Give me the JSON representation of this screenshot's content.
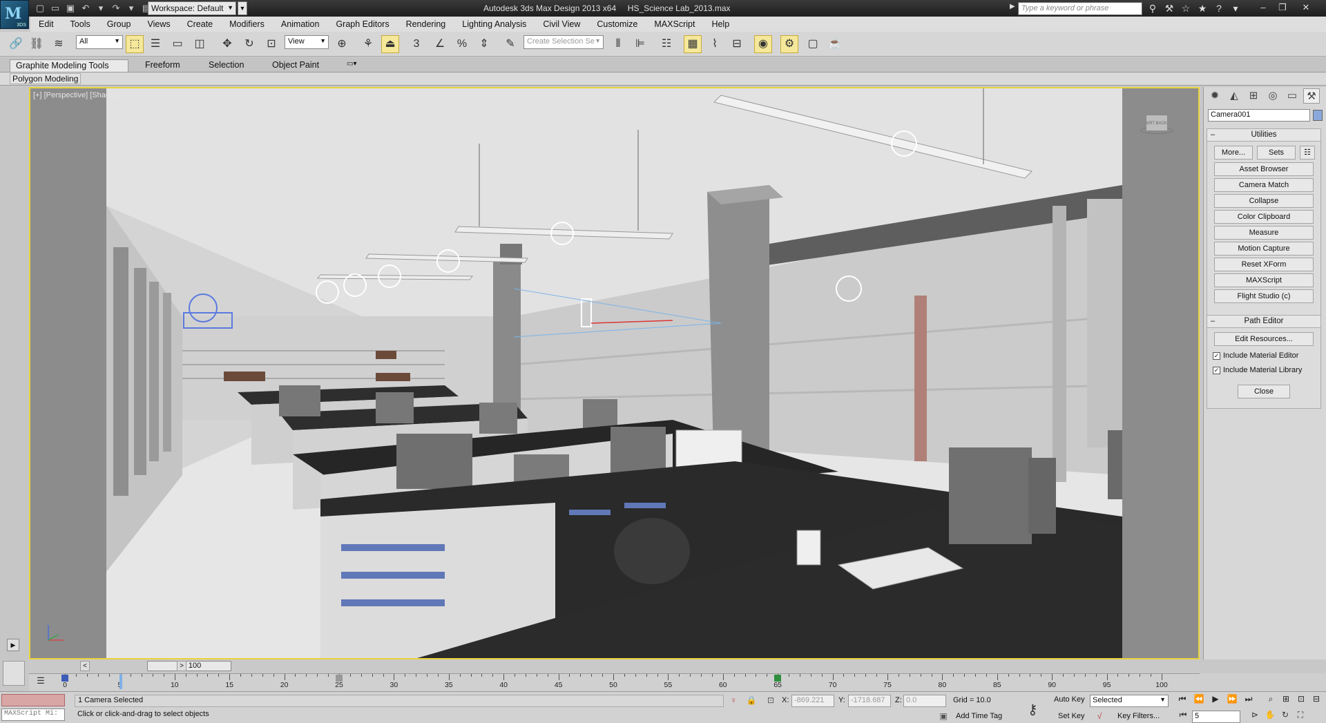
{
  "app": {
    "logo_text": "3DS",
    "title": "Autodesk 3ds Max Design 2013 x64     HS_Science Lab_2013.max",
    "workspace": "Workspace: Default",
    "search_placeholder": "Type a keyword or phrase"
  },
  "menu": [
    "Edit",
    "Tools",
    "Group",
    "Views",
    "Create",
    "Modifiers",
    "Animation",
    "Graph Editors",
    "Rendering",
    "Lighting Analysis",
    "Civil View",
    "Customize",
    "MAXScript",
    "Help"
  ],
  "toolbar": {
    "selection_filter": "All",
    "reference_coord": "View",
    "named_selection_placeholder": "Create Selection Se",
    "snap_labels": [
      "3",
      "%"
    ]
  },
  "ribbon": {
    "tabs": [
      "Graphite Modeling Tools",
      "Freeform",
      "Selection",
      "Object Paint"
    ],
    "active_tab": "Graphite Modeling Tools",
    "panel": "Polygon Modeling"
  },
  "viewport": {
    "label": "[+] [Perspective] [Shaded]",
    "viewcube_text": "KRT BACK",
    "border_color": "#e9d33c"
  },
  "command_panel": {
    "object_name": "Camera001",
    "object_color": "#8aa8dc",
    "utilities": {
      "title": "Utilities",
      "more": "More...",
      "sets": "Sets",
      "items": [
        "Asset Browser",
        "Camera Match",
        "Collapse",
        "Color Clipboard",
        "Measure",
        "Motion Capture",
        "Reset XForm",
        "MAXScript",
        "Flight Studio (c)"
      ]
    },
    "path_editor": {
      "title": "Path Editor",
      "edit_resources": "Edit Resources...",
      "include_material_editor": "Include Material Editor",
      "include_material_library": "Include Material Library",
      "include_material_editor_checked": true,
      "include_material_library_checked": true,
      "close": "Close"
    }
  },
  "timeline": {
    "current_frame": 5,
    "total_frames": 100,
    "slider_label": "5 / 100",
    "ticks": [
      0,
      5,
      10,
      15,
      20,
      25,
      30,
      35,
      40,
      45,
      50,
      55,
      60,
      65,
      70,
      75,
      80,
      85,
      90,
      95,
      100
    ],
    "key_frames": [
      0,
      25,
      65
    ],
    "key_colors": [
      "#3c5cb8",
      "#999999",
      "#2e8f3e"
    ]
  },
  "status": {
    "selection": "1 Camera Selected",
    "prompt": "Click or click-and-drag to select objects",
    "maxscript_mini": "MAXScript Mi:",
    "x_label": "X:",
    "x_value": "-869.221",
    "y_label": "Y:",
    "y_value": "-1718.687",
    "z_label": "Z:",
    "z_value": "0.0",
    "grid": "Grid = 10.0",
    "add_time_tag": "Add Time Tag",
    "auto_key": "Auto Key",
    "set_key": "Set Key",
    "key_mode": "Selected",
    "key_filters": "Key Filters...",
    "frame_field": "5"
  }
}
